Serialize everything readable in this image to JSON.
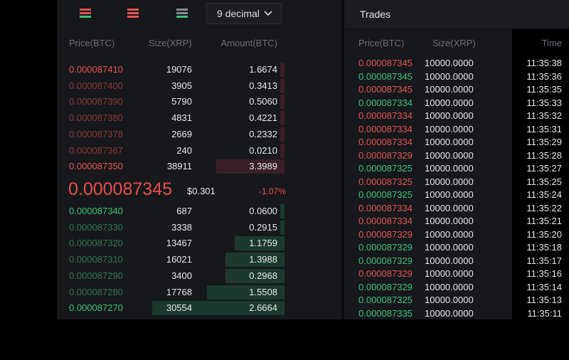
{
  "orderbook": {
    "decimal_select": "9 decimal",
    "headers": {
      "price": "Price(BTC)",
      "size": "Size(XRP)",
      "amount": "Amount(BTC)"
    },
    "asks": [
      {
        "price": "0.000087410",
        "size": "19076",
        "amount": "1.6674",
        "depth": 0.02
      },
      {
        "price": "0.000087400",
        "size": "3905",
        "amount": "0.3413",
        "depth": 0.02
      },
      {
        "price": "0.000087390",
        "size": "5790",
        "amount": "0.5060",
        "depth": 0.02
      },
      {
        "price": "0.000087380",
        "size": "4831",
        "amount": "0.4221",
        "depth": 0.02
      },
      {
        "price": "0.000087378",
        "size": "2669",
        "amount": "0.2332",
        "depth": 0.02
      },
      {
        "price": "0.000087367",
        "size": "240",
        "amount": "0.0210",
        "depth": 0.02
      },
      {
        "price": "0.000087350",
        "size": "38911",
        "amount": "3.3989",
        "depth": 0.3
      }
    ],
    "mid": {
      "price": "0.000087345",
      "usd": "$0.301",
      "change": "-1.07%"
    },
    "bids": [
      {
        "price": "0.000087340",
        "size": "687",
        "amount": "0.0600",
        "depth": 0.02
      },
      {
        "price": "0.000087330",
        "size": "3338",
        "amount": "0.2915",
        "depth": 0.02
      },
      {
        "price": "0.000087320",
        "size": "13467",
        "amount": "1.1759",
        "depth": 0.22
      },
      {
        "price": "0.000087310",
        "size": "16021",
        "amount": "1.3988",
        "depth": 0.26
      },
      {
        "price": "0.000087290",
        "size": "3400",
        "amount": "0.2968",
        "depth": 0.26
      },
      {
        "price": "0.000087280",
        "size": "17768",
        "amount": "1.5508",
        "depth": 0.34
      },
      {
        "price": "0.000087270",
        "size": "30554",
        "amount": "2.6664",
        "depth": 0.58
      }
    ]
  },
  "trades": {
    "title": "Trades",
    "headers": {
      "price": "Price(BTC)",
      "size": "Size(XRP)",
      "time": "Time"
    },
    "rows": [
      {
        "price": "0.000087345",
        "size": "10000.0000",
        "time": "11:35:38",
        "side": "sell"
      },
      {
        "price": "0.000087345",
        "size": "10000.0000",
        "time": "11:35:36",
        "side": "buy"
      },
      {
        "price": "0.000087345",
        "size": "10000.0000",
        "time": "11:35:35",
        "side": "sell"
      },
      {
        "price": "0.000087334",
        "size": "10000.0000",
        "time": "11:35:33",
        "side": "buy"
      },
      {
        "price": "0.000087334",
        "size": "10000.0000",
        "time": "11:35:32",
        "side": "sell"
      },
      {
        "price": "0.000087334",
        "size": "10000.0000",
        "time": "11:35:31",
        "side": "sell"
      },
      {
        "price": "0.000087334",
        "size": "10000.0000",
        "time": "11:35:29",
        "side": "sell"
      },
      {
        "price": "0.000087329",
        "size": "10000.0000",
        "time": "11:35:28",
        "side": "sell"
      },
      {
        "price": "0.000087325",
        "size": "10000.0000",
        "time": "11:35:27",
        "side": "buy"
      },
      {
        "price": "0.000087325",
        "size": "10000.0000",
        "time": "11:35:25",
        "side": "sell"
      },
      {
        "price": "0.000087325",
        "size": "10000.0000",
        "time": "11:35:24",
        "side": "buy"
      },
      {
        "price": "0.000087334",
        "size": "10000.0000",
        "time": "11:35:22",
        "side": "sell"
      },
      {
        "price": "0.000087334",
        "size": "10000.0000",
        "time": "11:35:21",
        "side": "sell"
      },
      {
        "price": "0.000087329",
        "size": "10000.0000",
        "time": "11:35:20",
        "side": "sell"
      },
      {
        "price": "0.000087329",
        "size": "10000.0000",
        "time": "11:35:18",
        "side": "buy"
      },
      {
        "price": "0.000087329",
        "size": "10000.0000",
        "time": "11:35:17",
        "side": "buy"
      },
      {
        "price": "0.000087329",
        "size": "10000.0000",
        "time": "11:35:16",
        "side": "sell"
      },
      {
        "price": "0.000087329",
        "size": "10000.0000",
        "time": "11:35:14",
        "side": "buy"
      },
      {
        "price": "0.000087325",
        "size": "10000.0000",
        "time": "11:35:13",
        "side": "buy"
      },
      {
        "price": "0.000087335",
        "size": "10000.0000",
        "time": "11:35:11",
        "side": "buy"
      }
    ]
  },
  "colors": {
    "sell": "#e05555",
    "buy": "#3ec17b",
    "panel": "#17181c",
    "ask_depth": "#3a2026",
    "bid_depth": "#1b3a2d"
  }
}
